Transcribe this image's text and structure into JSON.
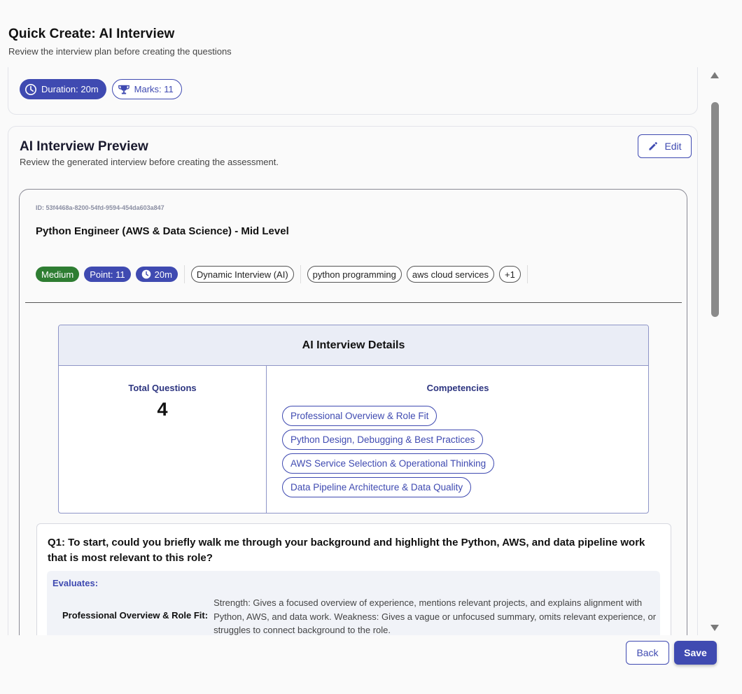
{
  "header": {
    "title": "Quick Create: AI Interview",
    "subtitle": "Review the interview plan before creating the questions"
  },
  "summary": {
    "duration_label": "Duration: 20m",
    "marks_label": "Marks: 11"
  },
  "preview": {
    "title": "AI Interview Preview",
    "subtitle": "Review the generated interview before creating the assessment.",
    "edit_label": "Edit",
    "id_text": "ID: 53f4468a-8200-54fd-9594-454da603a847",
    "job_title": "Python Engineer (AWS & Data Science) - Mid Level",
    "chips": {
      "difficulty": "Medium",
      "points": "Point: 11",
      "time": "20m",
      "type": "Dynamic Interview (AI)",
      "skills": [
        "python programming",
        "aws cloud services"
      ],
      "more": "+1"
    },
    "details": {
      "heading": "AI Interview Details",
      "total_label": "Total Questions",
      "total_value": "4",
      "competencies_label": "Competencies",
      "competencies": [
        "Professional Overview & Role Fit",
        "Python Design, Debugging & Best Practices",
        "AWS Service Selection & Operational Thinking",
        "Data Pipeline Architecture & Data Quality"
      ]
    },
    "question": {
      "text": "Q1: To start, could you briefly walk me through your background and highlight the Python, AWS, and data pipeline work that is most relevant to this role?",
      "evaluates_label": "Evaluates:",
      "criteria_key": "Professional Overview & Role Fit:",
      "criteria_value": "Strength: Gives a focused overview of experience, mentions relevant projects, and explains alignment with Python, AWS, and data work. Weakness: Gives a vague or unfocused summary, omits relevant experience, or struggles to connect background to the role."
    }
  },
  "footer": {
    "back_label": "Back",
    "save_label": "Save"
  },
  "colors": {
    "accent": "#3f4ab1",
    "success": "#2e7d32"
  }
}
